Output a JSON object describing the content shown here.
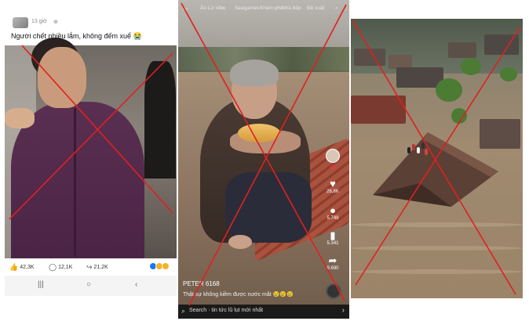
{
  "facebook_post": {
    "time": "13 giờ",
    "caption": "Người chết nhiều lắm, không đếm xuể 😭",
    "likes": "42,3K",
    "comments": "12,1K",
    "shares": "21,2K",
    "icons": {
      "like": "thumbs-up-icon",
      "comment": "comment-icon",
      "share": "share-icon",
      "mute": "mute-icon"
    },
    "nav": {
      "recent": "|||",
      "home": "○",
      "back": "‹"
    }
  },
  "tiktok_video": {
    "top_tabs": [
      "Ảo Lừ Vibe",
      "Seagames",
      "Khám phá",
      "Nhà bếp",
      "Đề xuất"
    ],
    "right_rail": [
      {
        "icon": "heart-icon",
        "count": "26,8K"
      },
      {
        "icon": "comment-icon",
        "count": "5.749"
      },
      {
        "icon": "bookmark-icon",
        "count": "5.341"
      },
      {
        "icon": "share-icon",
        "count": "9.690"
      }
    ],
    "username": "PETER 6168",
    "description": "Thật sự không kiềm được nước mắt 😢😢😢",
    "search_text": "Search · tin tức lũ lụt mới nhất"
  },
  "colors": {
    "cross": "#e02020",
    "accent": "#fe2c55"
  }
}
